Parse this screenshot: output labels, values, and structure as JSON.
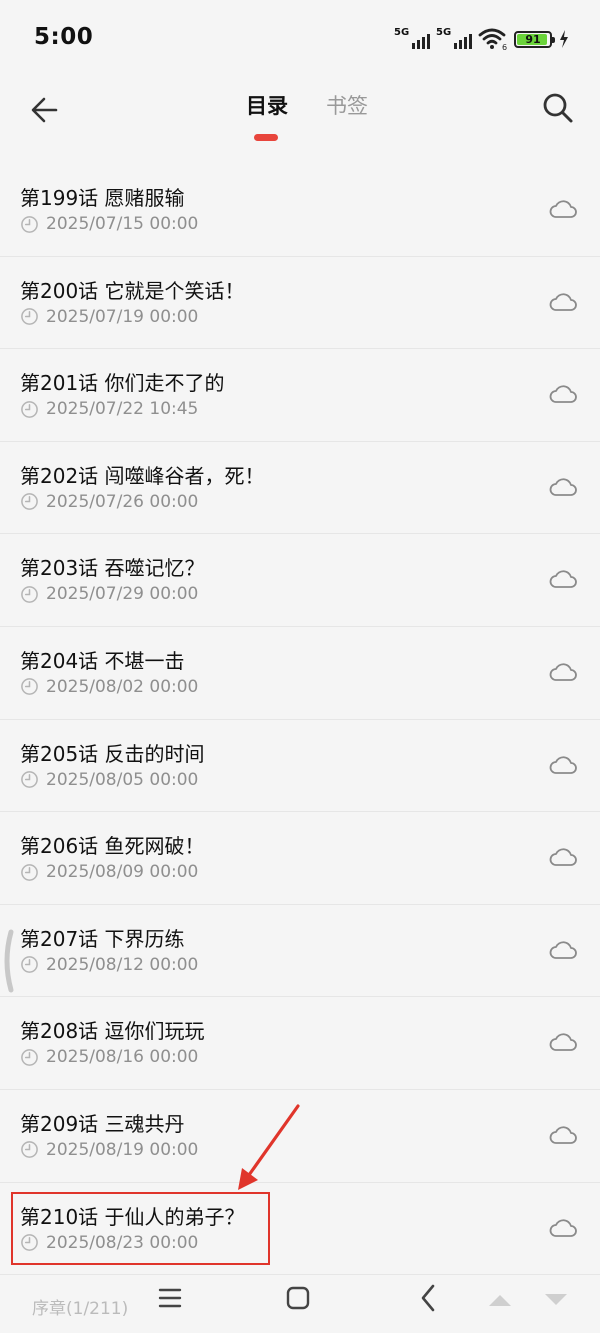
{
  "status_bar": {
    "time": "5:00",
    "signal1": "5G",
    "signal2": "5G",
    "wifi_sub": "6",
    "battery": "91"
  },
  "header": {
    "back_icon": "arrow-left-icon",
    "tab_toc": "目录",
    "tab_bookmark": "书签",
    "search_icon": "search-icon",
    "accent": "#e8453c"
  },
  "chapters": [
    {
      "title": "第199话 愿赌服输",
      "date": "2025/07/15 00:00"
    },
    {
      "title": "第200话 它就是个笑话！",
      "date": "2025/07/19 00:00"
    },
    {
      "title": "第201话 你们走不了的",
      "date": "2025/07/22 10:45"
    },
    {
      "title": "第202话 闯噬峰谷者，死！",
      "date": "2025/07/26 00:00"
    },
    {
      "title": "第203话 吞噬记忆？",
      "date": "2025/07/29 00:00"
    },
    {
      "title": "第204话 不堪一击",
      "date": "2025/08/02 00:00"
    },
    {
      "title": "第205话 反击的时间",
      "date": "2025/08/05 00:00"
    },
    {
      "title": "第206话 鱼死网破！",
      "date": "2025/08/09 00:00"
    },
    {
      "title": "第207话 下界历练",
      "date": "2025/08/12 00:00"
    },
    {
      "title": "第208话 逗你们玩玩",
      "date": "2025/08/16 00:00"
    },
    {
      "title": "第209话 三魂共丹",
      "date": "2025/08/19 00:00"
    },
    {
      "title": "第210话 于仙人的弟子？",
      "date": "2025/08/23 00:00"
    }
  ],
  "bottom": {
    "progress": "序章(1/211)"
  }
}
